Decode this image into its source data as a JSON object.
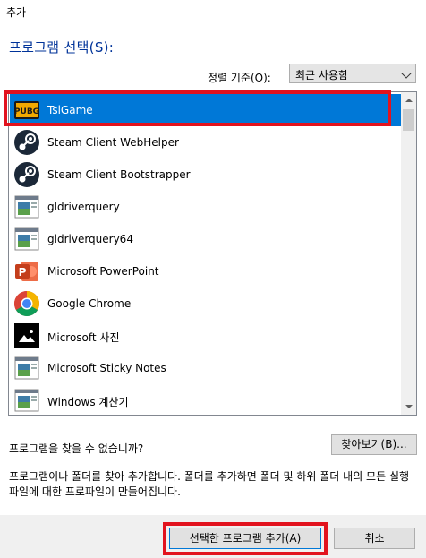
{
  "window": {
    "title": "추가"
  },
  "header": {
    "title": "프로그램 선택(S):"
  },
  "sort": {
    "label": "정렬 기준(O):",
    "selected": "최근 사용함"
  },
  "programs": [
    {
      "label": "TslGame",
      "icon": "pubg-icon",
      "selected": true
    },
    {
      "label": "Steam Client WebHelper",
      "icon": "steam-icon"
    },
    {
      "label": "Steam Client Bootstrapper",
      "icon": "steam-icon"
    },
    {
      "label": "gldriverquery",
      "icon": "generic-app-icon"
    },
    {
      "label": "gldriverquery64",
      "icon": "generic-app-icon"
    },
    {
      "label": "Microsoft PowerPoint",
      "icon": "powerpoint-icon"
    },
    {
      "label": "Google Chrome",
      "icon": "chrome-icon"
    },
    {
      "label": "Microsoft 사진",
      "icon": "photos-icon"
    },
    {
      "label": "Microsoft Sticky Notes",
      "icon": "generic-app-icon"
    },
    {
      "label": "Windows 계산기",
      "icon": "generic-app-icon"
    }
  ],
  "not_found": {
    "text": "프로그램을 찾을 수 없습니까?",
    "browse_label": "찾아보기(B)..."
  },
  "description": "프로그램이나 폴더를 찾아 추가합니다. 폴더를 추가하면 폴더 및 하위 폴더 내의 모든 실행 파일에 대한 프로파일이 만들어집니다.",
  "buttons": {
    "add_label": "선택한 프로그램 추가(A)",
    "cancel_label": "취소"
  },
  "colors": {
    "selection": "#0078d7",
    "header_text": "#003399",
    "annotation_red": "#e2131e"
  }
}
